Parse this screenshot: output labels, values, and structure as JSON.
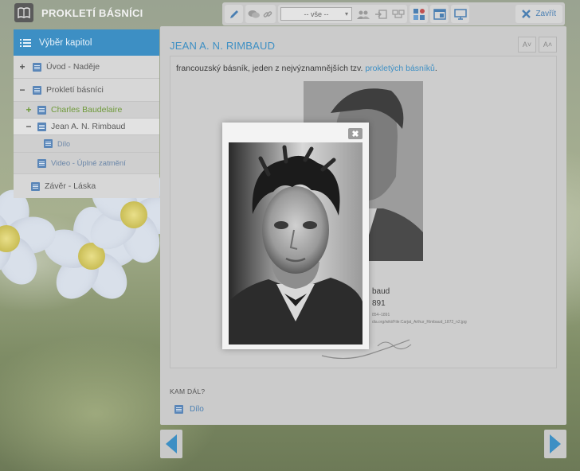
{
  "app": {
    "title": "PROKLETÍ BÁSNÍCI"
  },
  "toolbar": {
    "filter_value": "-- vše --",
    "close_label": "Zavřít"
  },
  "sidebar": {
    "header": "Výběr kapitol",
    "items": [
      {
        "toggle": "+",
        "label": "Úvod - Naděje"
      },
      {
        "toggle": "−",
        "label": "Prokletí básníci"
      },
      {
        "toggle": "+",
        "label": "Charles Baudelaire"
      },
      {
        "toggle": "−",
        "label": "Jean A. N. Rimbaud"
      },
      {
        "toggle": "",
        "label": "Dílo"
      },
      {
        "toggle": "",
        "label": "Video - Úplné zatmění"
      },
      {
        "toggle": "",
        "label": "Závěr - Láska"
      }
    ]
  },
  "main": {
    "title": "JEAN A. N. RIMBAUD",
    "font_decrease": "A˅",
    "font_increase": "A˄",
    "intro_text": "francouzský básník, jeden z nejvýznamnějších tzv.",
    "intro_link": "prokletých básníků",
    "intro_end": ".",
    "caption_name": "baud",
    "caption_year": "891",
    "caption_dates": "854–1891",
    "caption_source": "dia.org/wiki/File:Carjat_Arthur_Rimbaud_1872_n2.jpg",
    "next_heading": "KAM DÁL?",
    "next_link": "Dílo"
  },
  "modal": {
    "close_symbol": "✖"
  },
  "colors": {
    "accent": "#3d8fc4",
    "link_green": "#6f9a3a",
    "overlay_gray": "#cbcbcb"
  }
}
